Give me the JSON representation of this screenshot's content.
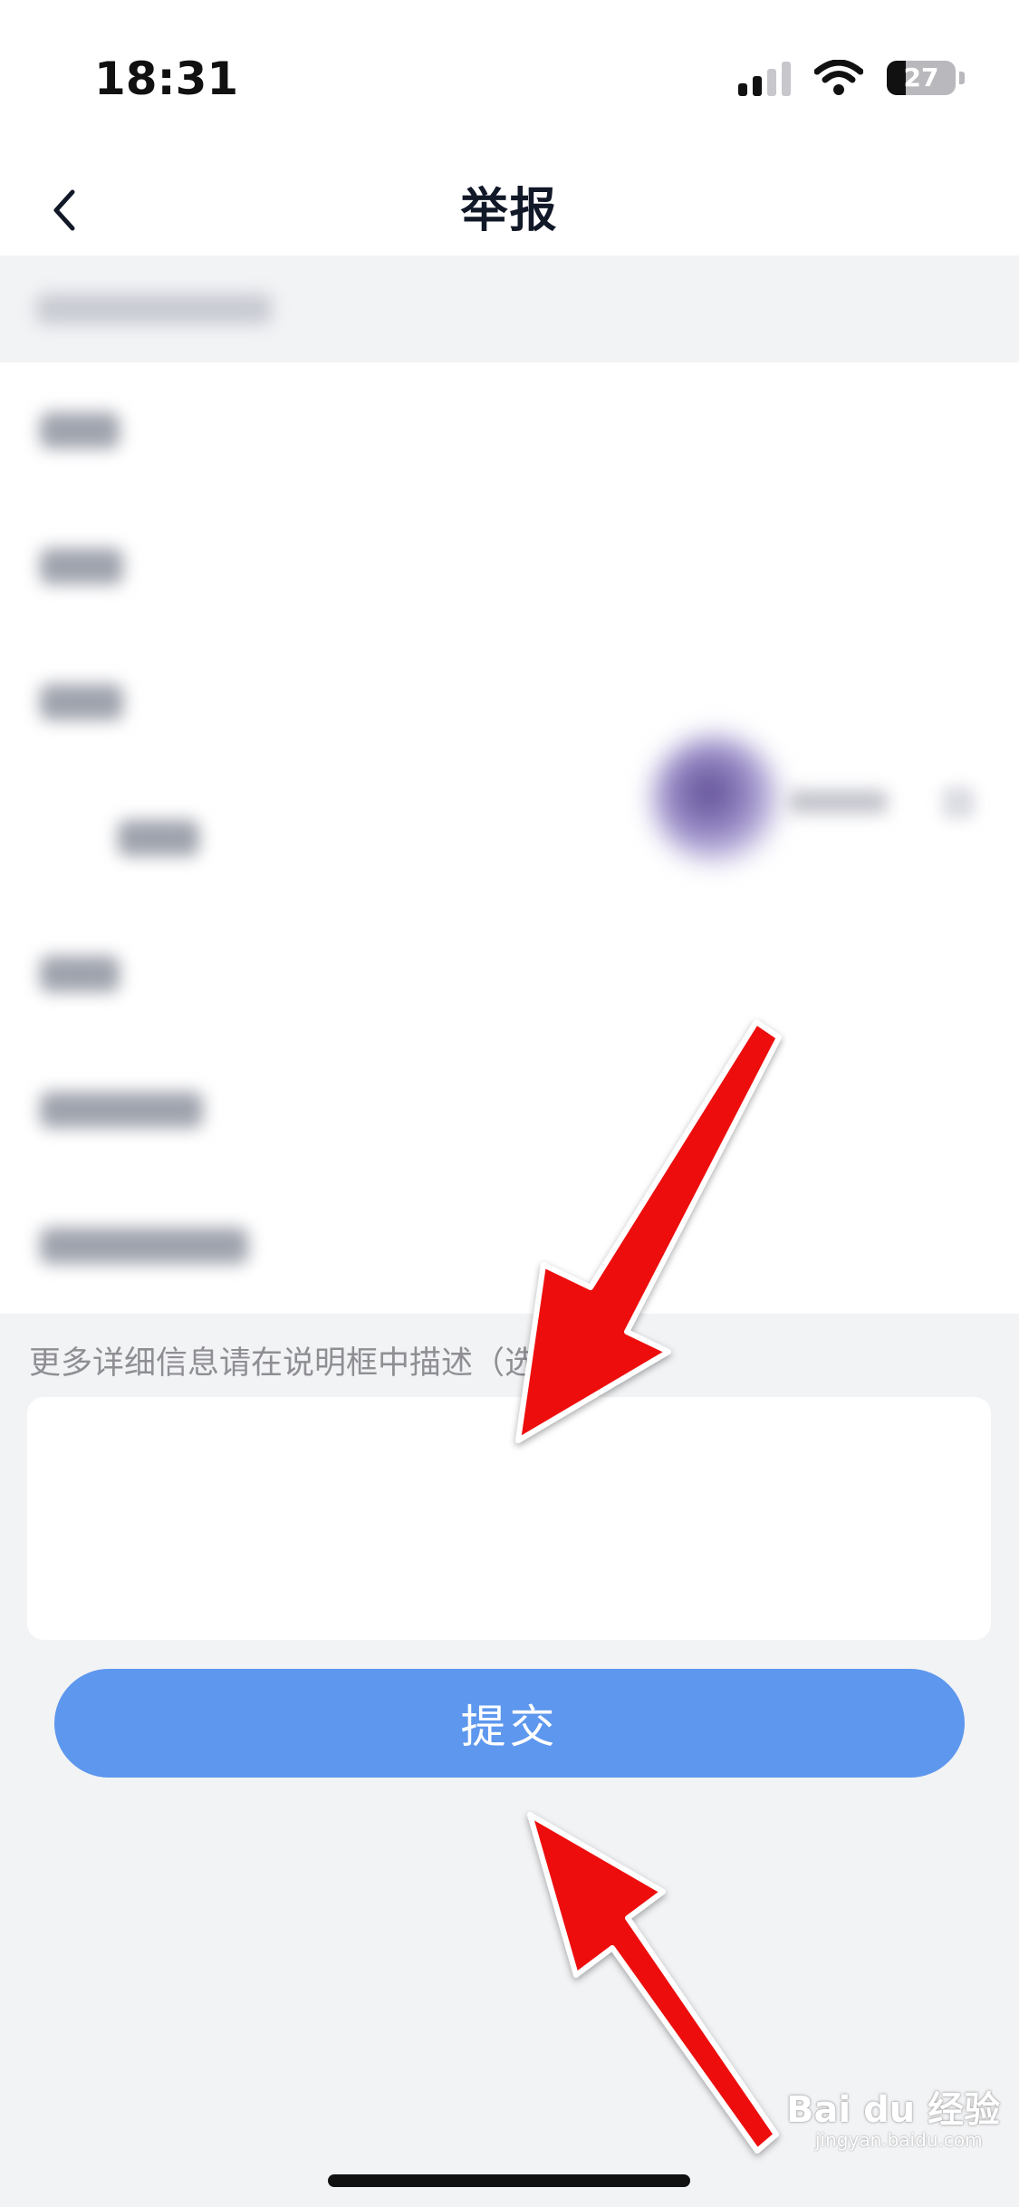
{
  "status_bar": {
    "time": "18:31",
    "battery": "27"
  },
  "nav": {
    "title": "举报",
    "back_icon": "chevron-left-icon"
  },
  "form": {
    "hint": "更多详细信息请在说明框中描述（选填)",
    "description_value": "",
    "submit_label": "提交"
  },
  "colors": {
    "accent": "#5d97ee",
    "annotation_arrow": "#ee1111",
    "background": "#f2f3f5"
  },
  "watermark": {
    "brand": "Bai du 经验",
    "site": "jingyan.baidu.com"
  }
}
